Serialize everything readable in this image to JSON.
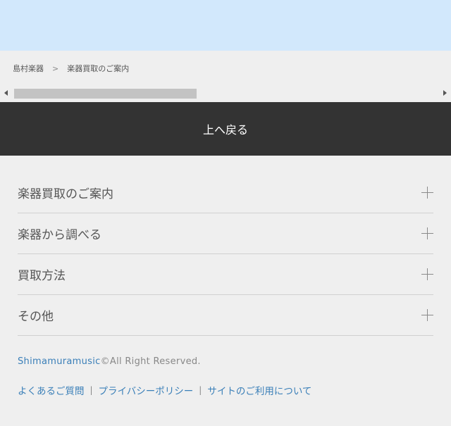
{
  "breadcrumb": {
    "home": "島村楽器",
    "separator": ">",
    "current": "楽器買取のご案内"
  },
  "back_to_top": "上へ戻る",
  "menu": {
    "items": [
      {
        "label": "楽器買取のご案内"
      },
      {
        "label": "楽器から調べる"
      },
      {
        "label": "買取方法"
      },
      {
        "label": "その他"
      }
    ]
  },
  "footer": {
    "brand": "Shimamuramusic",
    "copyright": "©All Right Reserved.",
    "links": [
      {
        "label": "よくあるご質問"
      },
      {
        "label": "プライバシーポリシー"
      },
      {
        "label": "サイトのご利用について"
      }
    ],
    "link_separator": "|"
  },
  "colors": {
    "banner": "#d2e8fc",
    "back_to_top_bg": "#333333",
    "link": "#3a7fb8",
    "page_bg": "#efefef"
  },
  "icons": [
    "plus-icon",
    "scroll-left-arrow-icon",
    "scroll-right-arrow-icon"
  ]
}
